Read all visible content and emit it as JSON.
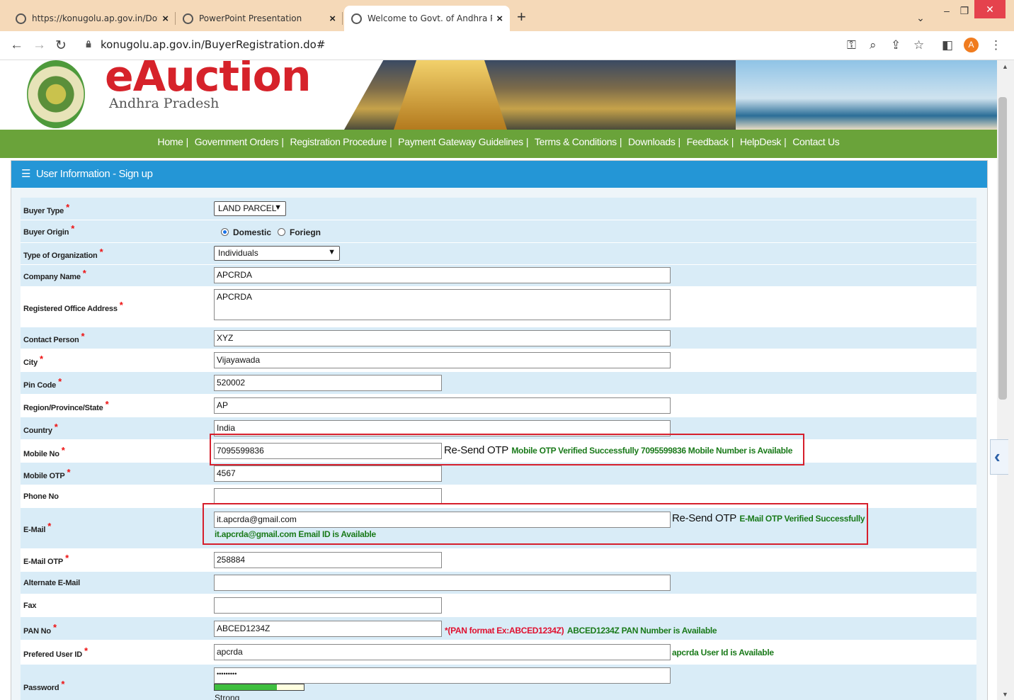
{
  "browser": {
    "tabs": [
      {
        "title": "https://konugolu.ap.gov.in/Down",
        "active": false
      },
      {
        "title": "PowerPoint Presentation",
        "active": false
      },
      {
        "title": "Welcome to Govt. of Andhra Pra",
        "active": true
      }
    ],
    "url": "konugolu.ap.gov.in/BuyerRegistration.do#",
    "profile_initial": "A"
  },
  "header": {
    "logo_title": "eAuction",
    "logo_subtitle": "Andhra Pradesh"
  },
  "menu": [
    "Home",
    "Government Orders",
    "Registration Procedure",
    "Payment Gateway Guidelines",
    "Terms & Conditions",
    "Downloads",
    "Feedback",
    "HelpDesk",
    "Contact Us"
  ],
  "panel": {
    "title": "User Information - Sign up"
  },
  "form": {
    "buyer_type": {
      "label": "Buyer Type",
      "value": "LAND PARCEL"
    },
    "buyer_origin": {
      "label": "Buyer Origin",
      "options": [
        "Domestic",
        "Foriegn"
      ],
      "selected": "Domestic"
    },
    "org_type": {
      "label": "Type of Organization",
      "value": "Individuals"
    },
    "company_name": {
      "label": "Company Name",
      "value": "APCRDA"
    },
    "office_address": {
      "label": "Registered Office Address",
      "value": "APCRDA"
    },
    "contact_person": {
      "label": "Contact Person",
      "value": "XYZ"
    },
    "city": {
      "label": "City",
      "value": "Vijayawada"
    },
    "pin_code": {
      "label": "Pin Code",
      "value": "520002"
    },
    "region": {
      "label": "Region/Province/State",
      "value": "AP"
    },
    "country": {
      "label": "Country",
      "value": "India"
    },
    "mobile": {
      "label": "Mobile No",
      "value": "7095599836",
      "resend": "Re-Send OTP",
      "status": "Mobile OTP Verified Successfully 7095599836 Mobile Number is Available"
    },
    "mobile_otp": {
      "label": "Mobile OTP",
      "value": "4567"
    },
    "phone": {
      "label": "Phone No",
      "value": ""
    },
    "email": {
      "label": "E-Mail",
      "value": "it.apcrda@gmail.com",
      "resend": "Re-Send OTP",
      "status": "E-Mail OTP Verified Successfully",
      "availability": "it.apcrda@gmail.com Email ID is Available"
    },
    "email_otp": {
      "label": "E-Mail OTP",
      "value": "258884"
    },
    "alt_email": {
      "label": "Alternate E-Mail",
      "value": ""
    },
    "fax": {
      "label": "Fax",
      "value": ""
    },
    "pan": {
      "label": "PAN No",
      "value": "ABCED1234Z",
      "hint": "*(PAN format Ex:ABCED1234Z)",
      "status": "ABCED1234Z PAN Number is Available"
    },
    "user_id": {
      "label": "Prefered User ID",
      "value": "apcrda",
      "status": "apcrda User Id is Available"
    },
    "password": {
      "label": "Password",
      "value": "•••••••••",
      "strength_label": "Strong",
      "strength": 0.7
    }
  },
  "colors": {
    "menu_bg": "#6aa33a",
    "panel_head": "#2496d6",
    "row_alt": "#d9ecf7",
    "success": "#1a7a1a",
    "required": "#e11111",
    "highlight_box": "#d61f2c"
  }
}
